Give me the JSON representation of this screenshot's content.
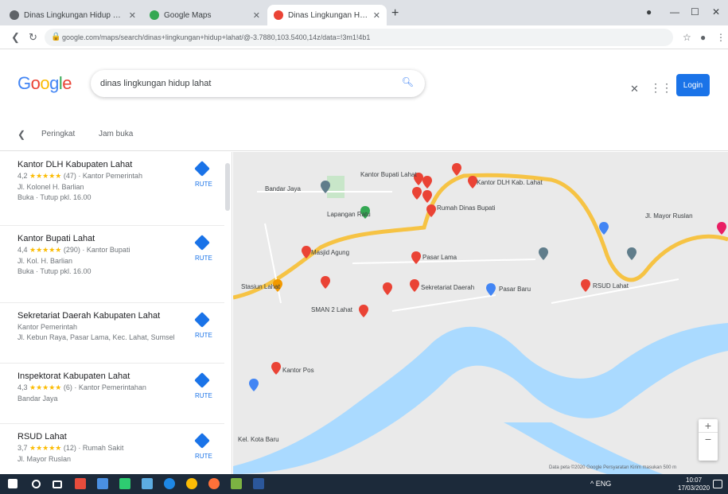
{
  "browser": {
    "tabs": [
      {
        "label": "Dinas Lingkungan Hidup Kab. L",
        "favicon_color": "#5f6368"
      },
      {
        "label": "Google Maps",
        "favicon_color": "#34a853"
      },
      {
        "label": "Dinas Lingkungan Hidup Lahat",
        "favicon_color": "#ea4335"
      }
    ],
    "new_tab_icon": "plus-icon",
    "url": "google.com/maps/search/dinas+lingkungan+hidup+lahat/@-3.7880,103.5400,14z/data=!3m1!4b1",
    "window_controls": [
      "minimize-icon",
      "maximize-icon",
      "close-icon"
    ]
  },
  "header": {
    "logo_text": "Google",
    "search_query": "dinas lingkungan hidup lahat",
    "signin_label": "Login"
  },
  "filters": {
    "back_icon": "chevron-left-icon",
    "items": [
      "Peringkat",
      "Jam buka"
    ]
  },
  "results": [
    {
      "name": "Kantor DLH Kabupaten Lahat",
      "rating": "4,2",
      "reviews": "(47)",
      "category": "Kantor Pemerintah",
      "address": "Jl. Kolonel H. Barlian",
      "hours": "Buka · Tutup pkl. 16.00",
      "action": "RUTE"
    },
    {
      "name": "Kantor Bupati Lahat",
      "rating": "4,4",
      "reviews": "(290)",
      "category": "Kantor Bupati",
      "address": "Jl. Kol. H. Barlian",
      "hours": "Buka · Tutup pkl. 16.00",
      "action": "RUTE"
    },
    {
      "name": "Sekretariat Daerah Kabupaten Lahat",
      "rating": "",
      "reviews": "",
      "category": "Kantor Pemerintah",
      "address": "Jl. Kebun Raya, Pasar Lama, Kec. Lahat, Sumsel",
      "hours": "",
      "action": "RUTE"
    },
    {
      "name": "Inspektorat Kabupaten Lahat",
      "rating": "4,3",
      "reviews": "(6)",
      "category": "Kantor Pemerintahan",
      "address": "Bandar Jaya",
      "hours": "",
      "action": "RUTE"
    },
    {
      "name": "RSUD Lahat",
      "rating": "3,7",
      "reviews": "(12)",
      "category": "Rumah Sakit",
      "address": "Jl. Mayor Ruslan",
      "hours": "",
      "action": "RUTE"
    }
  ],
  "map": {
    "labels": [
      "Bandar Jaya",
      "Lapangan Ratu",
      "Kantor Bupati Lahat",
      "Rumah Dinas Bupati",
      "Kantor DLH Kab. Lahat",
      "Masjid Agung",
      "Pasar Lama",
      "SMAN 2 Lahat",
      "Stasiun Lahat",
      "RSUD Lahat",
      "Sekretariat Daerah",
      "Pasar Baru",
      "Kantor Pos",
      "Kel. Kota Baru",
      "Jl. Mayor Ruslan"
    ],
    "footer": "Data peta ©2020 Google  Persyaratan  Kirim masukan  500 m"
  },
  "taskbar": {
    "apps": [
      "start-icon",
      "search-icon",
      "task-view-icon",
      "office-icon",
      "explorer-icon",
      "store-icon",
      "mail-icon",
      "edge-icon",
      "chrome-icon",
      "firefox-icon",
      "files-icon",
      "word-icon"
    ],
    "tray_text": "^ ENG",
    "time": "10:07",
    "date": "17/03/2020"
  }
}
